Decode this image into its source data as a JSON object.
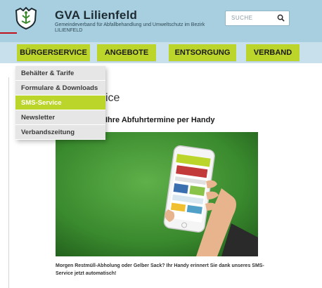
{
  "header": {
    "title": "GVA Lilienfeld",
    "subtitle": "Gemeindeverband für Abfallbehandlung und Umweltschutz im Bezirk LILIENFELD",
    "search_placeholder": "SUCHE",
    "search_icon": "search-icon",
    "logo_icon": "crest-icon"
  },
  "nav": {
    "items": [
      {
        "label": "BÜRGERSERVICE"
      },
      {
        "label": "ANGEBOTE"
      },
      {
        "label": "ENTSORGUNG"
      },
      {
        "label": "VERBAND"
      }
    ]
  },
  "dropdown": {
    "items": [
      {
        "label": "Behälter & Tarife",
        "active": false
      },
      {
        "label": "Formulare & Downloads",
        "active": false
      },
      {
        "label": "SMS-Service",
        "active": true
      },
      {
        "label": "Newsletter",
        "active": false
      },
      {
        "label": "Verbandszeitung",
        "active": false
      }
    ]
  },
  "content": {
    "heading_fragment": "ice",
    "subheading": "Ihre Abfuhrtermine per Handy",
    "body": "Morgen Restmüll-Abholung oder Gelber Sack? Ihr Handy erinnert Sie dank unseres SMS-Service jetzt automatisch!"
  },
  "colors": {
    "topbar": "#a8cfdf",
    "accent_green": "#bcd52a",
    "red_mark": "#c0121b"
  }
}
